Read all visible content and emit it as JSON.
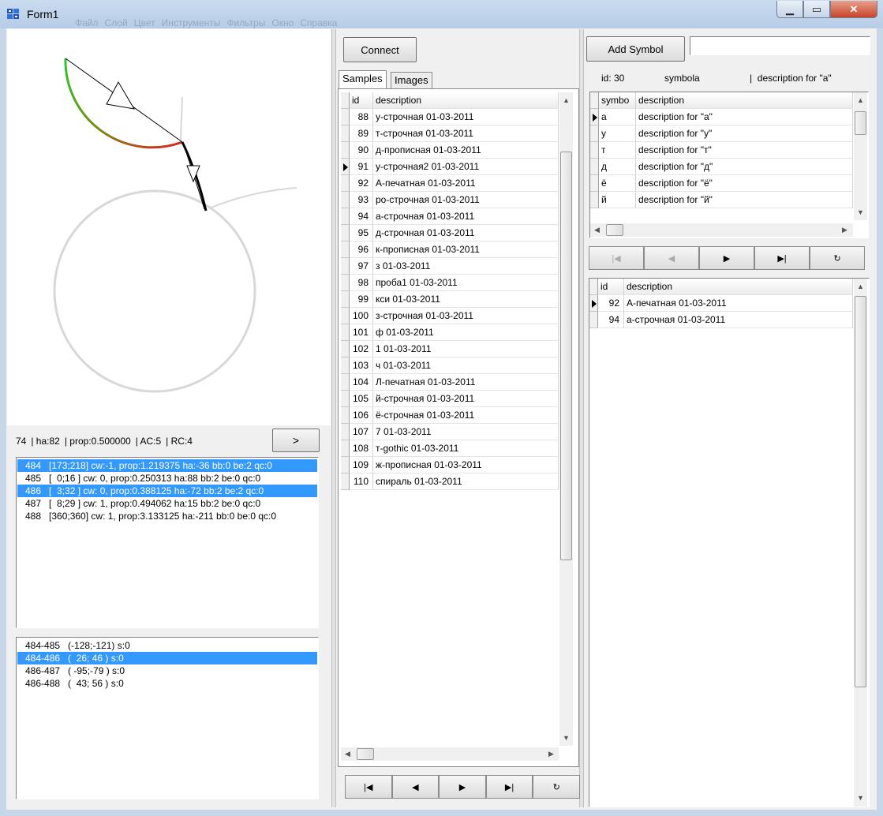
{
  "window": {
    "title": "Form1"
  },
  "menu_ghost": [
    "Файл",
    "Слой",
    "Цвет",
    "Инструменты",
    "Фильтры",
    "Окно",
    "Справка"
  ],
  "drawing": {
    "stats": {
      "id": "74",
      "ha": "| ha:82",
      "prop": "| prop:0.500000",
      "ac": "| AC:5",
      "rc": "| RC:4"
    },
    "next_button": ">"
  },
  "segments_list": [
    {
      "text": "484   [173;218] cw:-1, prop:1.219375 ha:-36 bb:0 be:2 qc:0",
      "selected": true
    },
    {
      "text": "485   [  0;16 ] cw: 0, prop:0.250313 ha:88 bb:2 be:0 qc:0",
      "selected": false
    },
    {
      "text": "486   [  3;32 ] cw: 0, prop:0.388125 ha:-72 bb:2 be:2 qc:0",
      "selected": true
    },
    {
      "text": "487   [  8;29 ] cw: 1, prop:0.494062 ha:15 bb:2 be:0 qc:0",
      "selected": false
    },
    {
      "text": "488   [360;360] cw: 1, prop:3.133125 ha:-211 bb:0 be:0 qc:0",
      "selected": false
    }
  ],
  "pairs_list": [
    {
      "text": "484-485   (-128;-121) s:0",
      "selected": false
    },
    {
      "text": "484-486   (  26; 46 ) s:0",
      "selected": true
    },
    {
      "text": "486-487   ( -95;-79 ) s:0",
      "selected": false
    },
    {
      "text": "486-488   (  43; 56 ) s:0",
      "selected": false
    }
  ],
  "middle": {
    "connect_button": "Connect",
    "tabs": [
      "Samples",
      "Images"
    ],
    "samples_grid": {
      "columns": [
        "id",
        "description"
      ],
      "current_id": "91",
      "rows": [
        [
          "88",
          "у-строчная 01-03-2011"
        ],
        [
          "89",
          "т-строчная 01-03-2011"
        ],
        [
          "90",
          "д-прописная 01-03-2011"
        ],
        [
          "91",
          "у-строчная2 01-03-2011"
        ],
        [
          "92",
          "А-печатная 01-03-2011"
        ],
        [
          "93",
          "ро-строчная 01-03-2011"
        ],
        [
          "94",
          "а-строчная 01-03-2011"
        ],
        [
          "95",
          "д-строчная 01-03-2011"
        ],
        [
          "96",
          "к-прописная 01-03-2011"
        ],
        [
          "97",
          "з 01-03-2011"
        ],
        [
          "98",
          "проба1 01-03-2011"
        ],
        [
          "99",
          "кси 01-03-2011"
        ],
        [
          "100",
          "з-строчная 01-03-2011"
        ],
        [
          "101",
          "ф 01-03-2011"
        ],
        [
          "102",
          "1 01-03-2011"
        ],
        [
          "103",
          "ч 01-03-2011"
        ],
        [
          "104",
          "Л-печатная 01-03-2011"
        ],
        [
          "105",
          "й-строчная 01-03-2011"
        ],
        [
          "106",
          "ё-строчная 01-03-2011"
        ],
        [
          "107",
          "7 01-03-2011"
        ],
        [
          "108",
          "т-gothic 01-03-2011"
        ],
        [
          "109",
          "ж-прописная 01-03-2011"
        ],
        [
          "110",
          "спираль 01-03-2011"
        ]
      ]
    },
    "nav_buttons": [
      "|◀",
      "◀",
      "▶",
      "▶|",
      "↻"
    ]
  },
  "right": {
    "add_symbol_button": "Add Symbol",
    "symbol_input": {
      "value": ""
    },
    "info": {
      "id": "id: 30",
      "symbol": "symbola",
      "description": "|  description for \"a\""
    },
    "symbols_grid": {
      "columns": [
        "symbo",
        "description"
      ],
      "rows": [
        [
          "a",
          "description for \"a\""
        ],
        [
          "у",
          "description for \"у\""
        ],
        [
          "т",
          "description for \"т\""
        ],
        [
          "д",
          "description for \"д\""
        ],
        [
          "ё",
          "description for \"ё\""
        ],
        [
          "й",
          "description for \"й\""
        ]
      ]
    },
    "nav_buttons": [
      "|◀",
      "◀",
      "▶",
      "▶|",
      "↻"
    ],
    "linked_grid": {
      "columns": [
        "id",
        "description"
      ],
      "rows": [
        [
          "92",
          "А-печатная 01-03-2011"
        ],
        [
          "94",
          "а-строчная 01-03-2011"
        ]
      ]
    }
  }
}
